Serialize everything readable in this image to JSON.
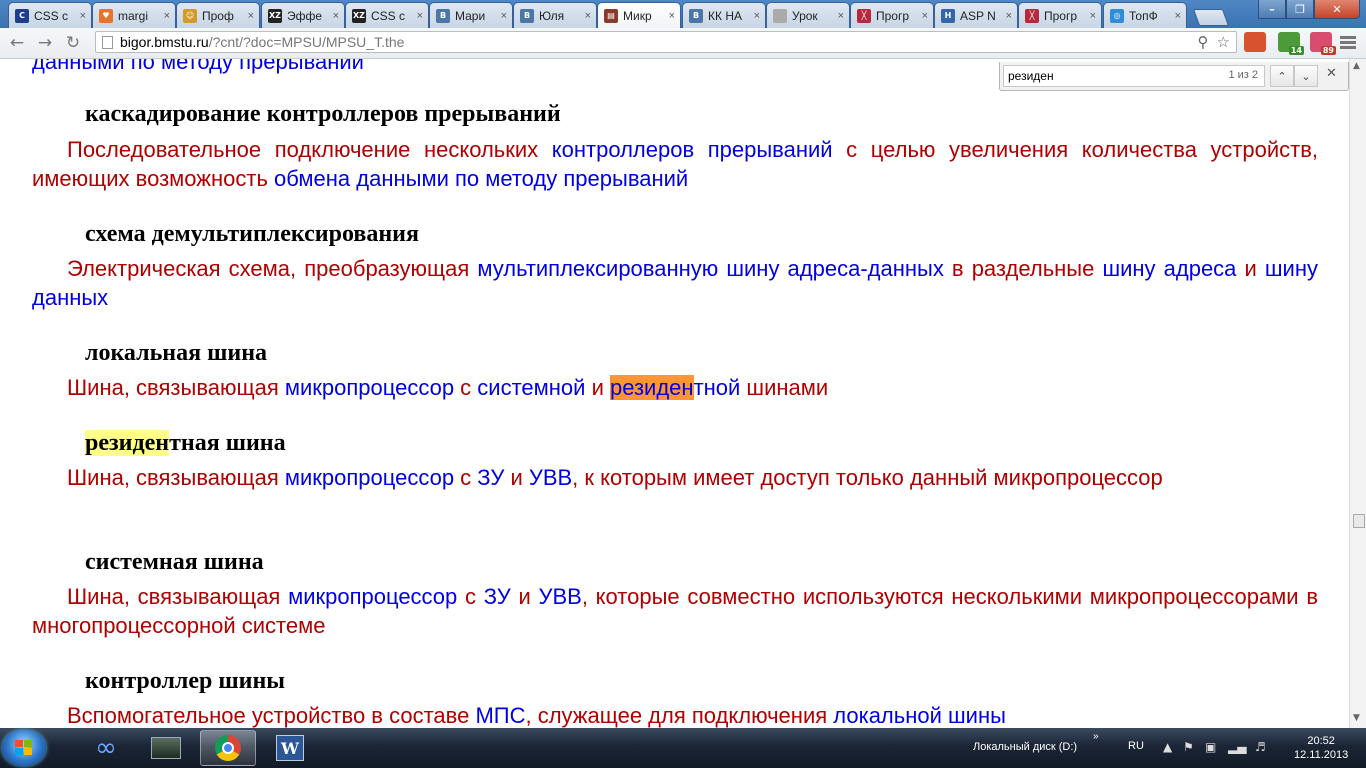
{
  "browser": {
    "tabs": [
      {
        "label": "CSS c",
        "icon": "css-site-icon",
        "color": "#1f3d8f",
        "glyph": "C"
      },
      {
        "label": "margi",
        "icon": "heart-icon",
        "color": "#e8742c",
        "glyph": "♥"
      },
      {
        "label": "Проф",
        "icon": "smiley-icon",
        "color": "#d39a2b",
        "glyph": "☺"
      },
      {
        "label": "Эффе",
        "icon": "xz-icon",
        "color": "#222222",
        "glyph": "XZ"
      },
      {
        "label": "CSS c",
        "icon": "xz-icon",
        "color": "#222222",
        "glyph": "XZ"
      },
      {
        "label": "Мари",
        "icon": "vk-icon",
        "color": "#4a76a8",
        "glyph": "B"
      },
      {
        "label": "Юля",
        "icon": "vk-icon",
        "color": "#4a76a8",
        "glyph": "B"
      },
      {
        "label": "Микр",
        "icon": "book-icon",
        "color": "#8a3b2b",
        "glyph": "▤"
      },
      {
        "label": "КК НА",
        "icon": "vk-icon",
        "color": "#4a76a8",
        "glyph": "B"
      },
      {
        "label": "Урок",
        "icon": "page-icon",
        "color": "#aaaaaa",
        "glyph": ""
      },
      {
        "label": "Прогр",
        "icon": "yoksel-icon",
        "color": "#b8283c",
        "glyph": "╳"
      },
      {
        "label": "ASP N",
        "icon": "h-icon",
        "color": "#3366aa",
        "glyph": "H"
      },
      {
        "label": "Прогр",
        "icon": "yoksel-icon",
        "color": "#b8283c",
        "glyph": "╳"
      },
      {
        "label": "ТопФ",
        "icon": "topface-icon",
        "color": "#2e8ed8",
        "glyph": "◎"
      }
    ],
    "active_tab_index": 7,
    "url": {
      "domain": "bigor.bmstu.ru",
      "path": "/?cnt/?doc=MPSU/MPSU_T.the"
    },
    "extensions": [
      {
        "icon": "bag-icon",
        "color": "#d9522e",
        "badge": ""
      },
      {
        "icon": "bars-extension-icon",
        "color": "#4c9a3a",
        "badge": "14",
        "badge_color": "#3a8a2e"
      },
      {
        "icon": "gift-extension-icon",
        "color": "#d84c6f",
        "badge": "89",
        "badge_color": "#c0392b"
      }
    ]
  },
  "find_bar": {
    "query": "резиден",
    "count": "1 из 2"
  },
  "content": {
    "top_partial": "данными по методу прерываний",
    "entries": [
      {
        "term": [
          "каскадирование контроллеров прерываний"
        ],
        "definition": [
          {
            "t": "Последовательное подключение нескольких ",
            "c": "r"
          },
          {
            "t": "контроллеров прерываний",
            "c": "b"
          },
          {
            "t": " с целью увеличения количества устройств, имеющих возможность ",
            "c": "r"
          },
          {
            "t": "обмена данными по методу прерываний",
            "c": "b"
          }
        ]
      },
      {
        "term": [
          "схема демультиплексирования"
        ],
        "definition": [
          {
            "t": "Электрическая схема, преобразующая ",
            "c": "r"
          },
          {
            "t": "мультиплексированную шину адреса-данных",
            "c": "b"
          },
          {
            "t": " в раздельные ",
            "c": "r"
          },
          {
            "t": "шину адреса",
            "c": "b"
          },
          {
            "t": " и ",
            "c": "r"
          },
          {
            "t": "шину данных",
            "c": "b"
          }
        ]
      },
      {
        "term": [
          "локальная шина"
        ],
        "definition": [
          {
            "t": "Шина, связывающая ",
            "c": "r"
          },
          {
            "t": "микропроцессор",
            "c": "b"
          },
          {
            "t": " с ",
            "c": "r"
          },
          {
            "t": "системной",
            "c": "b"
          },
          {
            "t": " и ",
            "c": "r"
          },
          {
            "t": "резиден",
            "c": "b",
            "hl": "current"
          },
          {
            "t": "тной",
            "c": "b"
          },
          {
            "t": " шинами",
            "c": "r"
          }
        ]
      },
      {
        "term": [
          "резиден",
          "тная шина"
        ],
        "term_highlight": true,
        "definition": [
          {
            "t": "Шина, связывающая ",
            "c": "r"
          },
          {
            "t": "микропроцессор",
            "c": "b"
          },
          {
            "t": " с ",
            "c": "r"
          },
          {
            "t": "ЗУ",
            "c": "b"
          },
          {
            "t": " и ",
            "c": "r"
          },
          {
            "t": "УВВ",
            "c": "b"
          },
          {
            "t": ", к которым имеет доступ только данный микропроцессор",
            "c": "r"
          }
        ]
      },
      {
        "term": [
          "системная шина"
        ],
        "definition": [
          {
            "t": "Шина, связывающая ",
            "c": "r"
          },
          {
            "t": "микропроцессор",
            "c": "b"
          },
          {
            "t": " с ",
            "c": "r"
          },
          {
            "t": "ЗУ",
            "c": "b"
          },
          {
            "t": " и ",
            "c": "r"
          },
          {
            "t": "УВВ",
            "c": "b"
          },
          {
            "t": ", которые совместно используются несколькими микропроцессорами в многопроцессорной системе",
            "c": "r"
          }
        ]
      },
      {
        "term": [
          "контроллер шины"
        ],
        "definition": [
          {
            "t": "Вспомогательное устройство в составе ",
            "c": "r"
          },
          {
            "t": "МПС",
            "c": "b"
          },
          {
            "t": ", служащее для подключения ",
            "c": "r"
          },
          {
            "t": "локальной шины",
            "c": "b"
          }
        ]
      }
    ]
  },
  "taskbar": {
    "tray_drive": "Локальный диск (D:)",
    "language": "RU",
    "time": "20:52",
    "date": "12.11.2013"
  },
  "colors": {
    "definition_red": "#b00000",
    "link_blue": "#0000e6",
    "find_current": "#ff9632",
    "find_match": "#ffff88"
  }
}
